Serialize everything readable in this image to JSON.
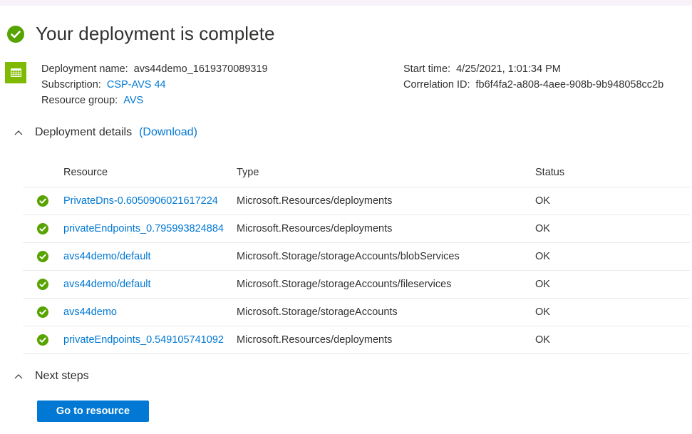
{
  "header": {
    "title": "Your deployment is complete",
    "status_icon": "check-circle-icon",
    "status_color": "#57a300"
  },
  "summary": {
    "icon": "deployment-grid-icon",
    "icon_color": "#7fba00",
    "deployment_name_label": "Deployment name:",
    "deployment_name_value": "avs44demo_1619370089319",
    "subscription_label": "Subscription:",
    "subscription_value": "CSP-AVS 44",
    "resource_group_label": "Resource group:",
    "resource_group_value": "AVS",
    "start_time_label": "Start time:",
    "start_time_value": "4/25/2021, 1:01:34 PM",
    "correlation_id_label": "Correlation ID:",
    "correlation_id_value": "fb6f4fa2-a808-4aee-908b-9b948058cc2b"
  },
  "deployment_details": {
    "label": "Deployment details",
    "download_label": "(Download)",
    "toggle_icon": "chevron-up-icon",
    "columns": [
      "Resource",
      "Type",
      "Status"
    ],
    "rows": [
      {
        "resource": "PrivateDns-0.6050906021617224",
        "type": "Microsoft.Resources/deployments",
        "status": "OK"
      },
      {
        "resource": "privateEndpoints_0.795993824884",
        "type": "Microsoft.Resources/deployments",
        "status": "OK"
      },
      {
        "resource": "avs44demo/default",
        "type": "Microsoft.Storage/storageAccounts/blobServices",
        "status": "OK"
      },
      {
        "resource": "avs44demo/default",
        "type": "Microsoft.Storage/storageAccounts/fileservices",
        "status": "OK"
      },
      {
        "resource": "avs44demo",
        "type": "Microsoft.Storage/storageAccounts",
        "status": "OK"
      },
      {
        "resource": "privateEndpoints_0.549105741092",
        "type": "Microsoft.Resources/deployments",
        "status": "OK"
      }
    ]
  },
  "next_steps": {
    "label": "Next steps",
    "toggle_icon": "chevron-up-icon",
    "go_to_resource_label": "Go to resource"
  },
  "colors": {
    "accent": "#0078d4",
    "success": "#57a300",
    "text": "#323130",
    "top_band": "#f8f3fb"
  }
}
